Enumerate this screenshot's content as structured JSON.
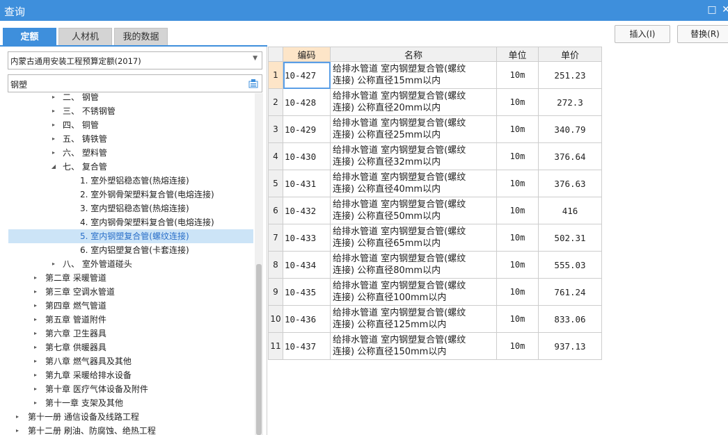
{
  "window": {
    "title": "查询"
  },
  "tabs": [
    "定额",
    "人材机",
    "我的数据"
  ],
  "actions": {
    "insert": "插入(I)",
    "replace": "替换(R)"
  },
  "filter": {
    "quota_book": "内蒙古通用安装工程预算定额(2017)",
    "search_value": "钢塑"
  },
  "tree": [
    {
      "label": "二、 钢管",
      "level": 3,
      "expander": "▸"
    },
    {
      "label": "三、 不锈钢管",
      "level": 3,
      "expander": "▸"
    },
    {
      "label": "四、 铜管",
      "level": 3,
      "expander": "▸"
    },
    {
      "label": "五、 铸铁管",
      "level": 3,
      "expander": "▸"
    },
    {
      "label": "六、 塑料管",
      "level": 3,
      "expander": "▸"
    },
    {
      "label": "七、 复合管",
      "level": 3,
      "expander": "◢"
    },
    {
      "label": "1. 室外塑铝稳态管(热熔连接)",
      "level": 4,
      "expander": ""
    },
    {
      "label": "2. 室外钢骨架塑料复合管(电熔连接)",
      "level": 4,
      "expander": ""
    },
    {
      "label": "3. 室内塑铝稳态管(热熔连接)",
      "level": 4,
      "expander": ""
    },
    {
      "label": "4. 室内钢骨架塑料复合管(电熔连接)",
      "level": 4,
      "expander": ""
    },
    {
      "label": "5. 室内钢塑复合管(螺纹连接)",
      "level": 4,
      "expander": "",
      "selected": true
    },
    {
      "label": "6. 室内铝塑复合管(卡套连接)",
      "level": 4,
      "expander": ""
    },
    {
      "label": "八、 室外管道碰头",
      "level": 3,
      "expander": "▸"
    },
    {
      "label": "第二章 采暖管道",
      "level": 2,
      "expander": "▸"
    },
    {
      "label": "第三章 空调水管道",
      "level": 2,
      "expander": "▸"
    },
    {
      "label": "第四章 燃气管道",
      "level": 2,
      "expander": "▸"
    },
    {
      "label": "第五章 管道附件",
      "level": 2,
      "expander": "▸"
    },
    {
      "label": "第六章 卫生器具",
      "level": 2,
      "expander": "▸"
    },
    {
      "label": "第七章 供暖器具",
      "level": 2,
      "expander": "▸"
    },
    {
      "label": "第八章 燃气器具及其他",
      "level": 2,
      "expander": "▸"
    },
    {
      "label": "第九章 采暖给排水设备",
      "level": 2,
      "expander": "▸"
    },
    {
      "label": "第十章 医疗气体设备及附件",
      "level": 2,
      "expander": "▸"
    },
    {
      "label": "第十一章 支架及其他",
      "level": 2,
      "expander": "▸"
    },
    {
      "label": "第十一册 通信设备及线路工程",
      "level": 1,
      "expander": "▸"
    },
    {
      "label": "第十二册 刷油、防腐蚀、绝热工程",
      "level": 1,
      "expander": "▸"
    }
  ],
  "grid": {
    "headers": [
      "编码",
      "名称",
      "单位",
      "单价"
    ],
    "rows": [
      {
        "no": "1",
        "code": "10-427",
        "name1": "给排水管道 室内钢塑复合管(螺纹",
        "name2": "连接) 公称直径15mm以内",
        "unit": "10m",
        "price": "251.23",
        "current": true
      },
      {
        "no": "2",
        "code": "10-428",
        "name1": "给排水管道 室内钢塑复合管(螺纹",
        "name2": "连接) 公称直径20mm以内",
        "unit": "10m",
        "price": "272.3"
      },
      {
        "no": "3",
        "code": "10-429",
        "name1": "给排水管道 室内钢塑复合管(螺纹",
        "name2": "连接) 公称直径25mm以内",
        "unit": "10m",
        "price": "340.79"
      },
      {
        "no": "4",
        "code": "10-430",
        "name1": "给排水管道 室内钢塑复合管(螺纹",
        "name2": "连接) 公称直径32mm以内",
        "unit": "10m",
        "price": "376.64"
      },
      {
        "no": "5",
        "code": "10-431",
        "name1": "给排水管道 室内钢塑复合管(螺纹",
        "name2": "连接) 公称直径40mm以内",
        "unit": "10m",
        "price": "376.63"
      },
      {
        "no": "6",
        "code": "10-432",
        "name1": "给排水管道 室内钢塑复合管(螺纹",
        "name2": "连接) 公称直径50mm以内",
        "unit": "10m",
        "price": "416"
      },
      {
        "no": "7",
        "code": "10-433",
        "name1": "给排水管道 室内钢塑复合管(螺纹",
        "name2": "连接) 公称直径65mm以内",
        "unit": "10m",
        "price": "502.31"
      },
      {
        "no": "8",
        "code": "10-434",
        "name1": "给排水管道 室内钢塑复合管(螺纹",
        "name2": "连接) 公称直径80mm以内",
        "unit": "10m",
        "price": "555.03"
      },
      {
        "no": "9",
        "code": "10-435",
        "name1": "给排水管道 室内钢塑复合管(螺纹",
        "name2": "连接) 公称直径100mm以内",
        "unit": "10m",
        "price": "761.24"
      },
      {
        "no": "10",
        "code": "10-436",
        "name1": "给排水管道 室内钢塑复合管(螺纹",
        "name2": "连接) 公称直径125mm以内",
        "unit": "10m",
        "price": "833.06"
      },
      {
        "no": "11",
        "code": "10-437",
        "name1": "给排水管道 室内钢塑复合管(螺纹",
        "name2": "连接) 公称直径150mm以内",
        "unit": "10m",
        "price": "937.13"
      }
    ]
  },
  "colors": {
    "accent": "#3e8fdc",
    "header_highlight": "#fde5c8",
    "selection": "#cce4f7"
  }
}
